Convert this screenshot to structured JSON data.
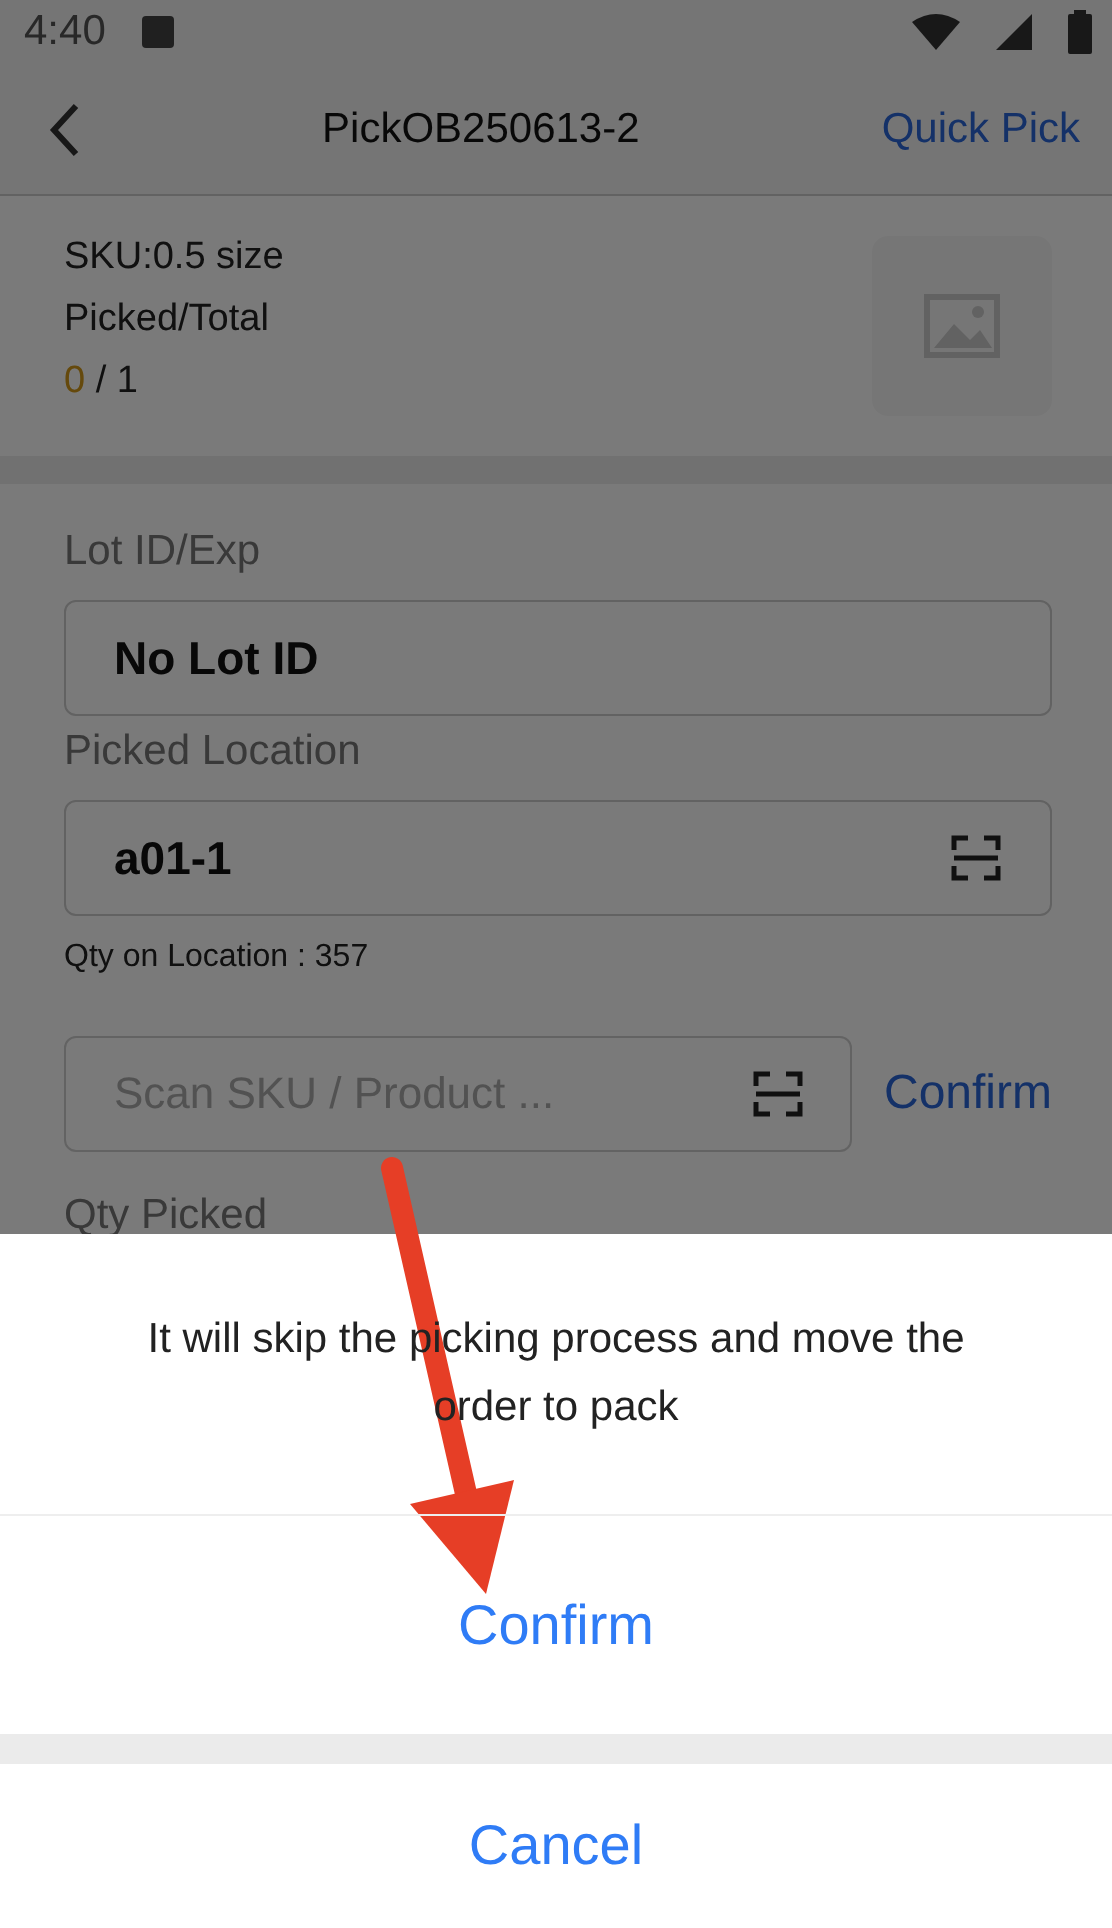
{
  "status_bar": {
    "time": "4:40"
  },
  "header": {
    "title": "PickOB250613-2",
    "action": "Quick Pick"
  },
  "item": {
    "sku": "SKU:0.5 size",
    "progress_label": "Picked/Total",
    "picked": "0",
    "total": "/ 1"
  },
  "fields": [
    {
      "label": "Lot ID/Exp",
      "value": "No Lot ID",
      "scan": false
    },
    {
      "label": "Picked Location",
      "value": "a01-1",
      "scan": true,
      "note": "Qty on Location : 357"
    }
  ],
  "scan": {
    "placeholder": "Scan SKU / Product ...",
    "button": "Confirm"
  },
  "next_label": "Qty Picked",
  "sheet": {
    "message": "It will skip the picking process and move the order to pack",
    "confirm": "Confirm",
    "cancel": "Cancel"
  }
}
